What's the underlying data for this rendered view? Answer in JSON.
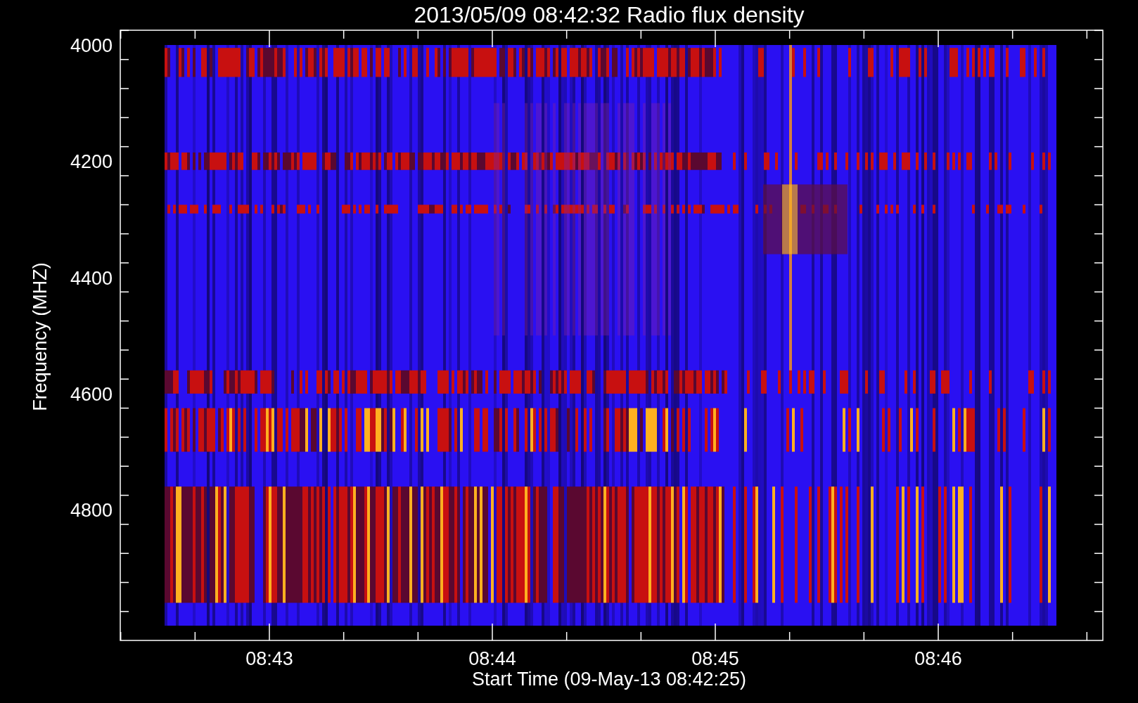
{
  "title": "2013/05/09 08:42:32 Radio flux density",
  "plot": {
    "ylabel": "Frequency (MHZ)",
    "xlabel": "Start Time (09-May-13 08:42:25)",
    "yticks": [
      {
        "label": "4000"
      },
      {
        "label": "4200"
      },
      {
        "label": "4400"
      },
      {
        "label": "4600"
      },
      {
        "label": "4800"
      }
    ],
    "xticks": [
      {
        "label": "08:43"
      },
      {
        "label": "08:44"
      },
      {
        "label": "08:45"
      },
      {
        "label": "08:46"
      }
    ]
  }
}
